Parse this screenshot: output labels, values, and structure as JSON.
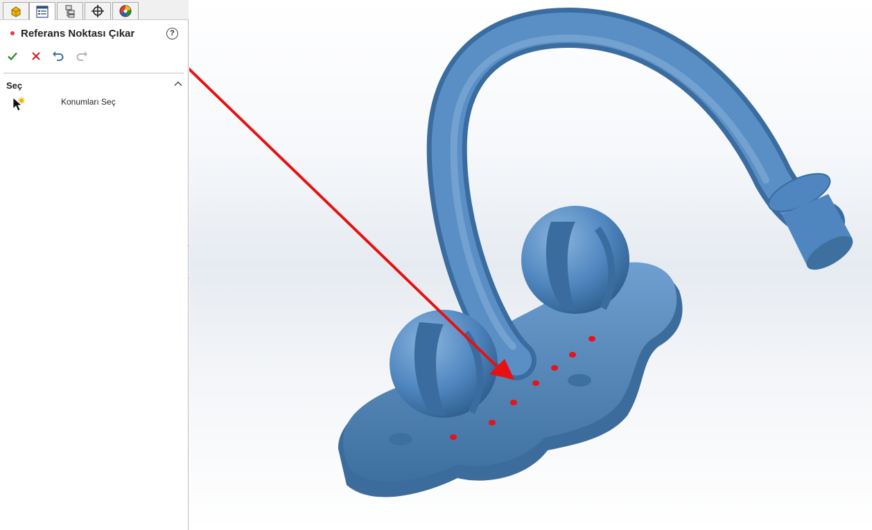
{
  "tabs": [
    {
      "name": "feature-manager",
      "icon": "parts-icon"
    },
    {
      "name": "property-manager",
      "icon": "property-manager-icon"
    },
    {
      "name": "configuration-manager",
      "icon": "configuration-icon"
    },
    {
      "name": "dimxpert-manager",
      "icon": "crosshair-icon"
    },
    {
      "name": "display-manager",
      "icon": "appearance-icon"
    }
  ],
  "panel": {
    "title": "Referans Noktası Çıkar",
    "help_symbol": "?",
    "section_title": "Seç",
    "pick_label": "Konumları Seç"
  },
  "actions": [
    {
      "name": "ok",
      "icon": "checkmark-icon",
      "color": "#2e8b2e"
    },
    {
      "name": "cancel",
      "icon": "x-icon",
      "color": "#d42020"
    },
    {
      "name": "undo",
      "icon": "undo-icon",
      "color": "#3a6ea5"
    },
    {
      "name": "redo",
      "icon": "redo-icon",
      "color": "#b5b5b5"
    }
  ],
  "colors": {
    "model": "#4f86bf",
    "model_dark": "#3a6c9f",
    "model_light": "#7eaad6",
    "points": "#e8121a",
    "arrow": "#e81010"
  },
  "viewport": {
    "model": "faucet-3d-model",
    "reference_point_count": 7
  }
}
